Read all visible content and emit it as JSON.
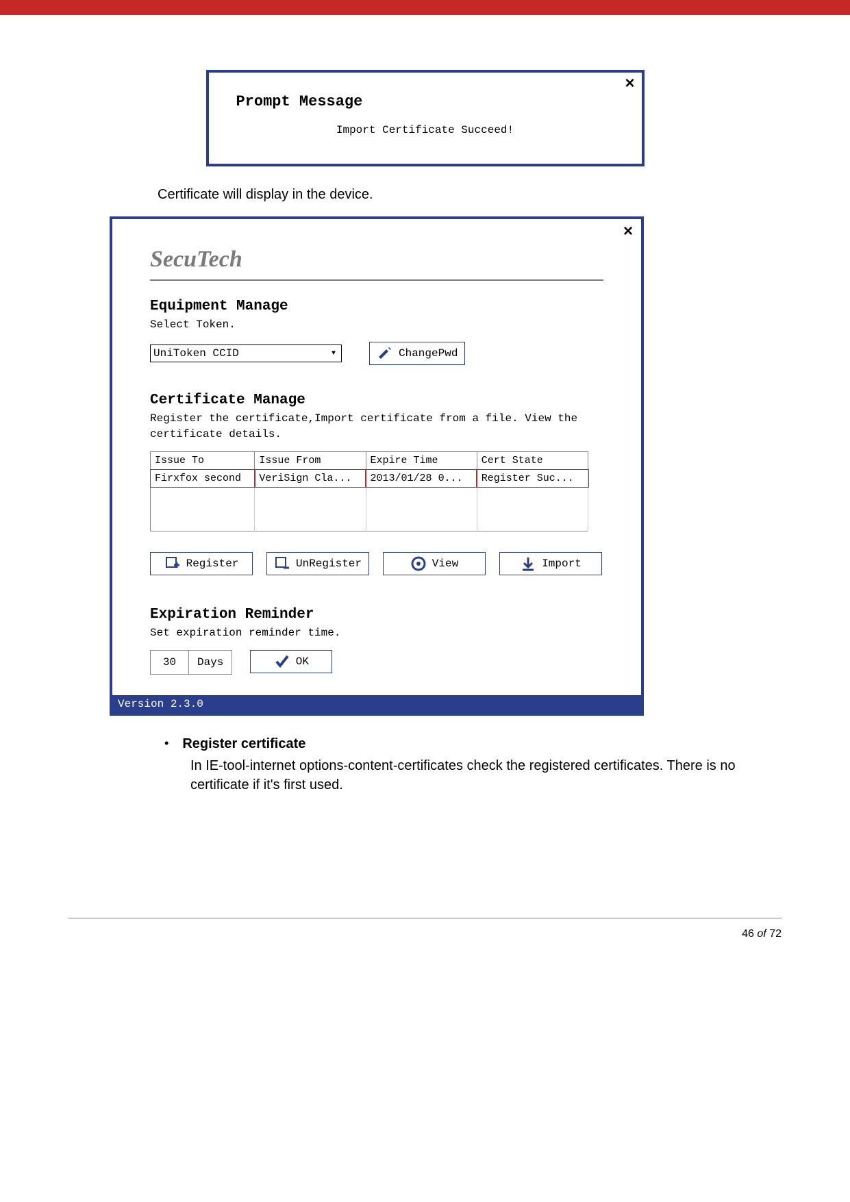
{
  "prompt": {
    "title": "Prompt Message",
    "message": "Import Certificate Succeed!",
    "close": "×"
  },
  "caption_after_prompt": "Certificate will display in the device.",
  "secutech": {
    "close": "×",
    "brand": "SecuTech",
    "equip": {
      "title": "Equipment Manage",
      "sub": "Select Token.",
      "selected": "UniToken CCID",
      "change_pwd": "ChangePwd"
    },
    "cert": {
      "title": "Certificate Manage",
      "sub": "Register the certificate,Import certificate from a file. View the certificate details.",
      "headers": {
        "c0": "Issue To",
        "c1": "Issue From",
        "c2": "Expire Time",
        "c3": "Cert State"
      },
      "row": {
        "c0": "Firxfox second",
        "c1": "VeriSign Cla...",
        "c2": "2013/01/28 0...",
        "c3": "Register Suc..."
      },
      "btn_register": "Register",
      "btn_unregister": "UnRegister",
      "btn_view": "View",
      "btn_import": "Import"
    },
    "exp": {
      "title": "Expiration Reminder",
      "sub": "Set expiration reminder time.",
      "days_value": "30",
      "days_label": "Days",
      "ok": "OK"
    },
    "version": "Version 2.3.0"
  },
  "bullet": {
    "title": "Register certificate",
    "body": "In IE-tool-internet options-content-certificates check the registered certificates. There is no certificate if it's first used."
  },
  "footer": {
    "page": "46",
    "of": "of",
    "total": "72"
  }
}
